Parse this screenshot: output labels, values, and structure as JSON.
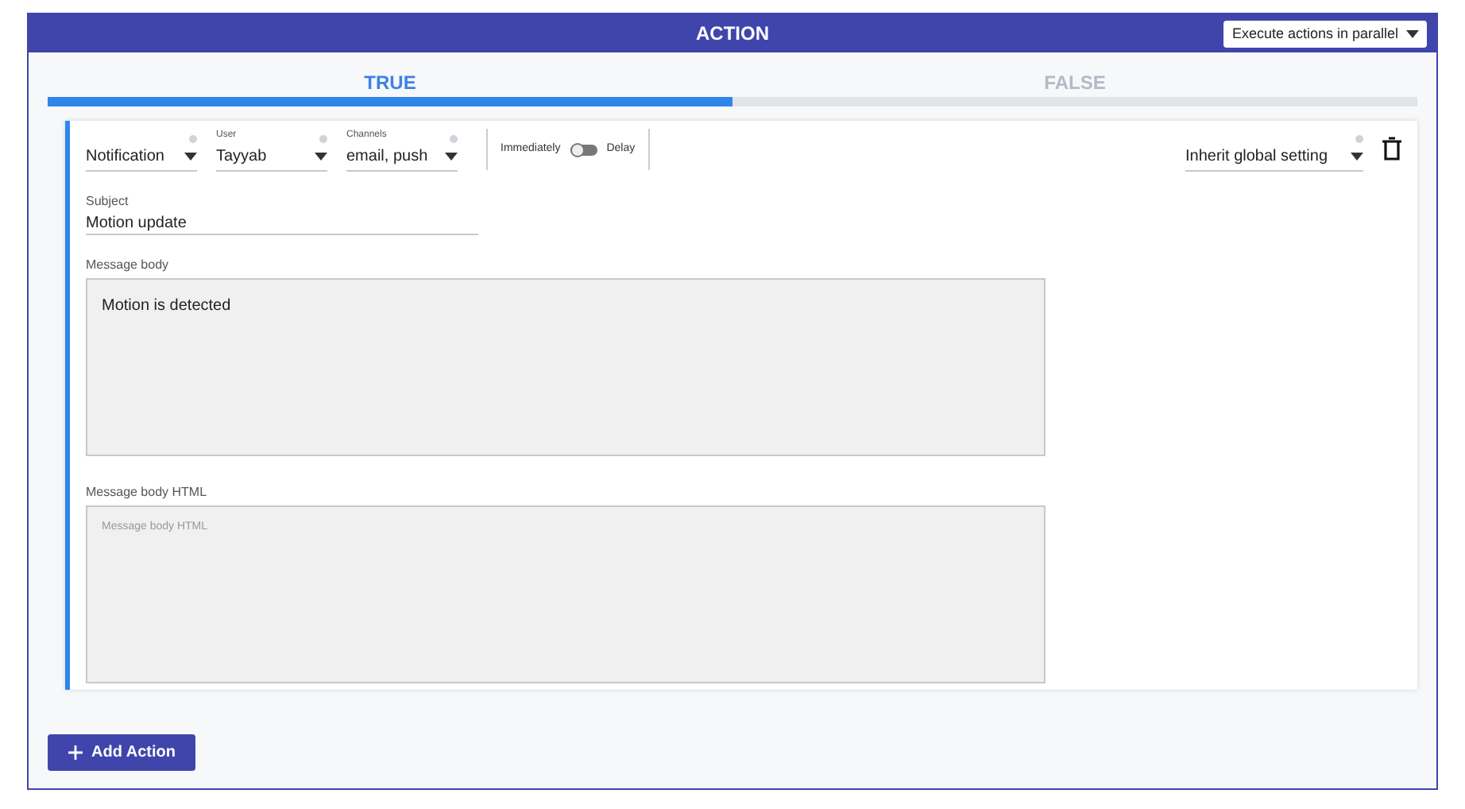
{
  "header": {
    "title": "ACTION",
    "mode_select": {
      "value": "Execute actions in parallel"
    }
  },
  "tabs": [
    {
      "label": "TRUE",
      "selected": true
    },
    {
      "label": "FALSE",
      "selected": false
    }
  ],
  "action": {
    "type_select": {
      "value": "Notification"
    },
    "user_select": {
      "label": "User",
      "value": "Tayyab"
    },
    "channels_select": {
      "label": "Channels",
      "value": "email, push"
    },
    "timing": {
      "left_label": "Immediately",
      "right_label": "Delay",
      "on": false
    },
    "setting_select": {
      "value": "Inherit global setting"
    },
    "subject": {
      "label": "Subject",
      "value": "Motion update"
    },
    "message_body": {
      "label": "Message body",
      "value": "Motion is detected"
    },
    "message_body_html": {
      "label": "Message body HTML",
      "placeholder": "Message body HTML"
    }
  },
  "add_button": {
    "label": "Add Action"
  }
}
